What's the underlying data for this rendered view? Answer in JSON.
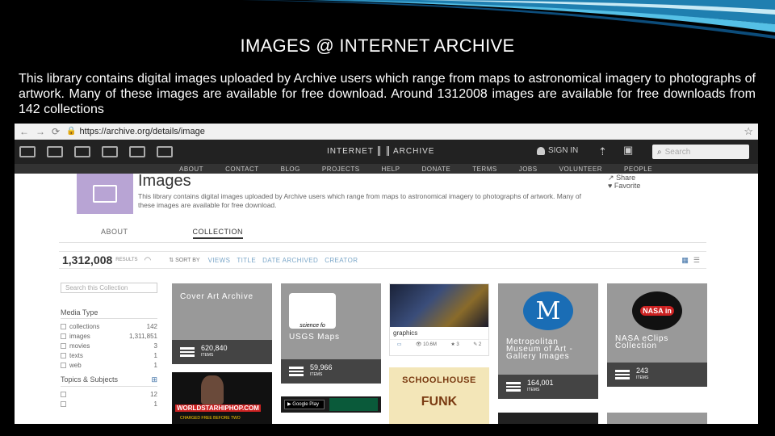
{
  "slide": {
    "title": "IMAGES @ INTERNET ARCHIVE",
    "body": "This library contains digital images uploaded by Archive users which range from maps to astronomical imagery to photographs of artwork. Many of these images are available for free download.  Around 1312008 images are available for free downloads from 142 collections"
  },
  "browser": {
    "url": "https://archive.org/details/image"
  },
  "topbar": {
    "brand_left": "INTERNET",
    "brand_right": "ARCHIVE",
    "signin": "SIGN IN",
    "search_placeholder": "Search"
  },
  "subnav": [
    "ABOUT",
    "CONTACT",
    "BLOG",
    "PROJECTS",
    "HELP",
    "DONATE",
    "TERMS",
    "JOBS",
    "VOLUNTEER",
    "PEOPLE"
  ],
  "collection": {
    "title": "Images",
    "description": "This library contains digital images uploaded by Archive users which range from maps to astronomical imagery to photographs of artwork. Many of these images are available for free download.",
    "share": "Share",
    "favorite": "Favorite",
    "tabs": [
      "ABOUT",
      "COLLECTION"
    ]
  },
  "sortbar": {
    "count": "1,312,008",
    "results_label": "RESULTS",
    "sort_by": "SORT BY",
    "options": [
      "VIEWS",
      "TITLE",
      "DATE ARCHIVED",
      "CREATOR"
    ]
  },
  "sidebar": {
    "search_placeholder": "Search this Collection",
    "media_type_heading": "Media Type",
    "media_types": [
      {
        "label": "collections",
        "count": "142"
      },
      {
        "label": "images",
        "count": "1,311,851"
      },
      {
        "label": "movies",
        "count": "3"
      },
      {
        "label": "texts",
        "count": "1"
      },
      {
        "label": "web",
        "count": "1"
      }
    ],
    "topics_heading": "Topics & Subjects",
    "topics": [
      {
        "label": "",
        "count": "12"
      },
      {
        "label": "",
        "count": "1"
      }
    ]
  },
  "tiles": {
    "cover_art": {
      "title": "Cover Art Archive",
      "count": "620,840",
      "unit": "ITEMS"
    },
    "usgs": {
      "title": "USGS Maps",
      "count": "59,966",
      "unit": "ITEMS",
      "logo_text": "science fo"
    },
    "movie": {
      "title": "graphics",
      "views": "10.6M",
      "favs": "3",
      "reviews": "2"
    },
    "met": {
      "title": "Metropolitan Museum of Art - Gallery Images",
      "count": "164,001",
      "unit": "ITEMS",
      "logo": "M"
    },
    "nasa": {
      "title": "NASA eClips Collection",
      "count": "243",
      "unit": "ITEMS",
      "logo": "NASA in"
    },
    "hiphop": {
      "banner": "WORLDSTARHIPHOP.COM",
      "sub": "CHARGED FREE BEFORE TWO"
    },
    "googleplay": {
      "label": "Google Play"
    },
    "funk": {
      "line1": "SCHOOLHOUSE",
      "line2": "FUNK"
    }
  },
  "colors": {
    "thumb_purple": "#b8a4d4",
    "tile_gray": "#999999",
    "tile_footer": "#444444",
    "met_blue": "#1a6db5",
    "nasa_red": "#cc2222",
    "sort_link": "#7aa6c8"
  }
}
